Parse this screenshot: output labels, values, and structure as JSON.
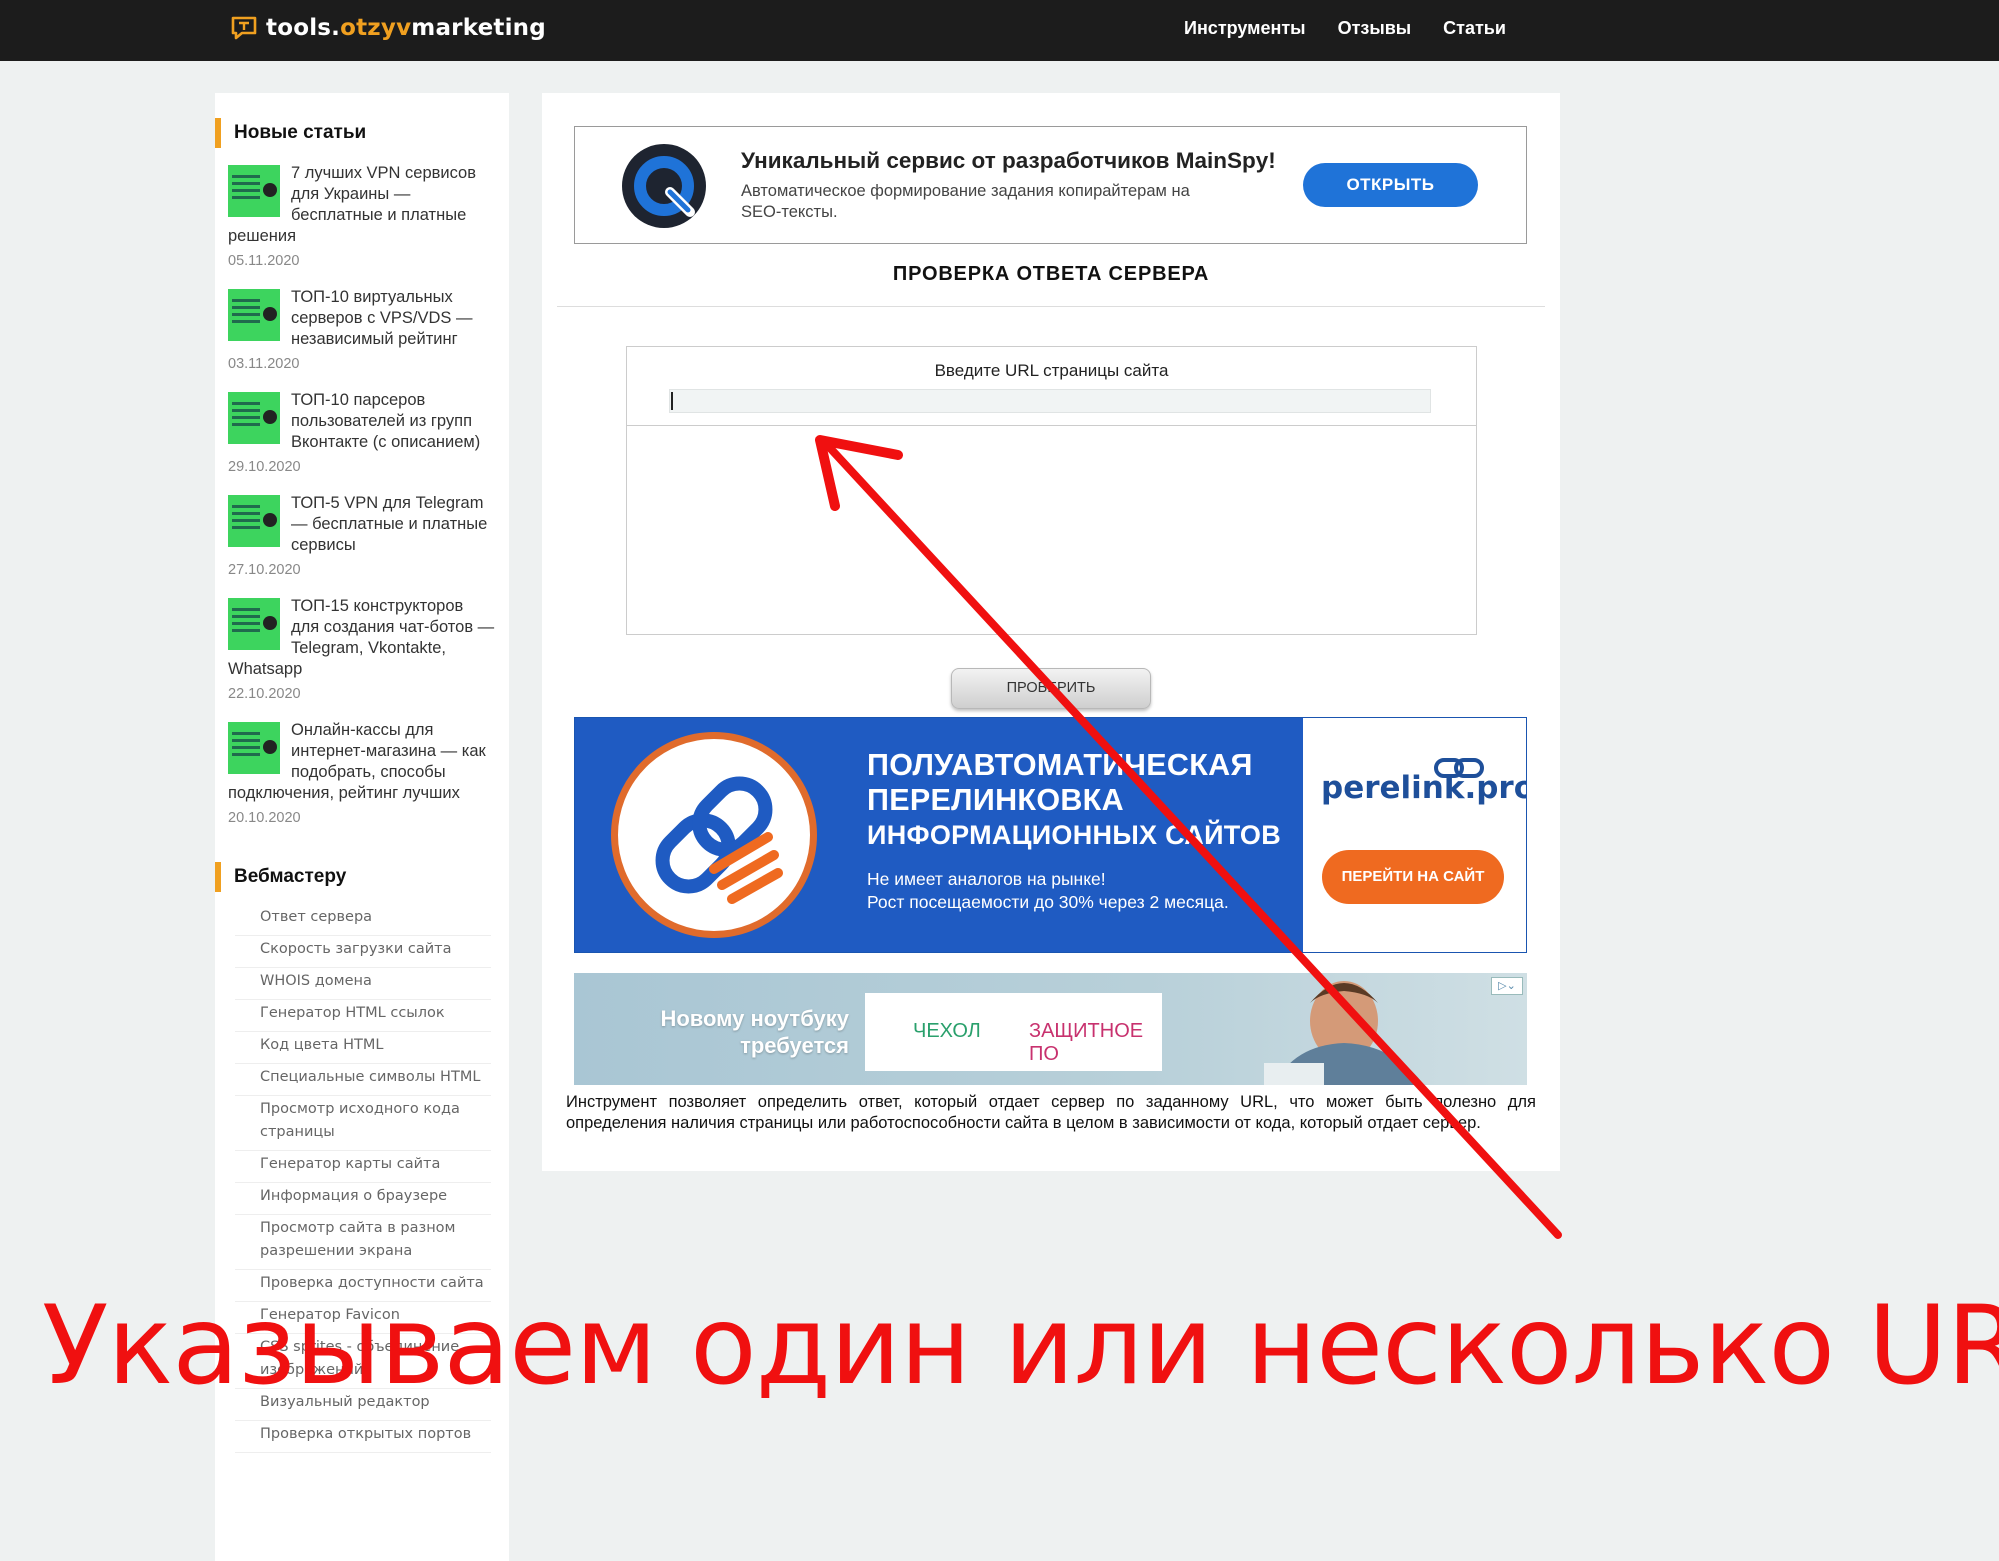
{
  "header": {
    "logo": {
      "part1": "tools.",
      "part2": "otzyv",
      "part3": "marketing"
    },
    "nav": [
      "Инструменты",
      "Отзывы",
      "Статьи"
    ]
  },
  "sidebar": {
    "new_articles_title": "Новые статьи",
    "articles": [
      {
        "title": "7 лучших VPN сервисов для Украины — бесплатные и платные решения",
        "date": "05.11.2020"
      },
      {
        "title": "ТОП-10 виртуальных серверов с VPS/VDS — независимый рейтинг",
        "date": "03.11.2020"
      },
      {
        "title": "ТОП-10 парсеров пользователей из групп Вконтакте (с описанием)",
        "date": "29.10.2020"
      },
      {
        "title": "ТОП-5 VPN для Telegram — бесплатные и платные сервисы",
        "date": "27.10.2020"
      },
      {
        "title": "ТОП-15 конструкторов для создания чат-ботов — Telegram, Vkontakte, Whatsapp",
        "date": "22.10.2020"
      },
      {
        "title": "Онлайн-кассы для интернет-магазина — как подобрать, способы подключения, рейтинг лучших",
        "date": "20.10.2020"
      }
    ],
    "webmaster_title": "Вебмастеру",
    "webmaster_links": [
      "Ответ сервера",
      "Скорость загрузки сайта",
      "WHOIS домена",
      "Генератор HTML ссылок",
      "Код цвета HTML",
      "Специальные символы HTML",
      "Просмотр исходного кода страницы",
      "Генератор карты сайта",
      "Информация о браузере",
      "Просмотр сайта в разном разрешении экрана",
      "Проверка доступности сайта",
      "Генератор Favicon",
      "CSS sprites - объединение изображений",
      "Визуальный редактор",
      "Проверка открытых портов"
    ]
  },
  "promo": {
    "title": "Уникальный сервис от разработчиков MainSpy!",
    "subtitle": "Автоматическое формирование задания копирайтерам на SEO-тексты.",
    "button": "ОТКРЫТЬ"
  },
  "tool": {
    "title": "ПРОВЕРКА ОТВЕТА СЕРВЕРА",
    "input_label": "Введите URL страницы сайта",
    "input_value": "",
    "button": "ПРОВЕРИТЬ"
  },
  "banner": {
    "headline1": "ПОЛУАВТОМАТИЧЕСКАЯ",
    "headline2": "ПЕРЕЛИНКОВКА",
    "headline3": "ИНФОРМАЦИОННЫХ САЙТОВ",
    "text1": "Не имеет аналогов на рынке!",
    "text2": "Рост посещаемости до 30% через 2 месяца.",
    "brand": "perelink.pro",
    "button": "ПЕРЕЙТИ НА САЙТ"
  },
  "ad2": {
    "text": "Новому ноутбуку требуется",
    "option1": "ЧЕХОЛ",
    "option2": "ЗАЩИТНОЕ ПО"
  },
  "description": "Инструмент позволяет определить ответ, который отдает сервер по заданному URL, что может быть полезно для определения наличия страницы или работоспособности сайта в целом в зависимости от кода, который отдает сервер.",
  "annotation": {
    "caption": "Указываем один или несколько URL",
    "color": "#f01010"
  },
  "colors": {
    "accent": "#f0a020",
    "header_bg": "#1c1c1c",
    "promo_button": "#1f73d8",
    "banner_bg": "#1f5bc2"
  }
}
